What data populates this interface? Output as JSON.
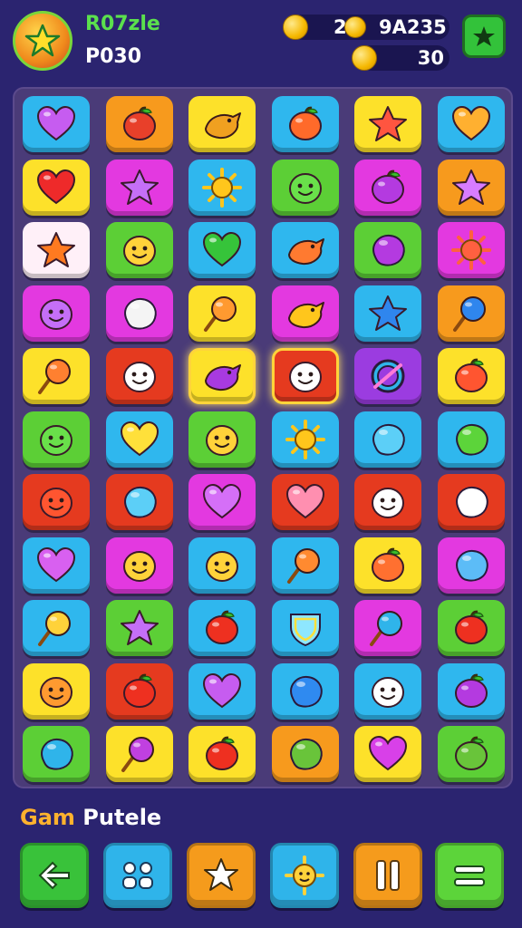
{
  "header": {
    "title": "R07zle",
    "subtitle": "P030",
    "coins_a": "2",
    "gems_a": "9A235",
    "coins_b": "30"
  },
  "footer": {
    "label_a": "Gam",
    "label_b": "Putele",
    "buttons": [
      {
        "name": "back-button",
        "icon": "arrow-left-icon",
        "color": "#39c23a"
      },
      {
        "name": "characters-button",
        "icon": "characters-icon",
        "color": "#2fb4ea"
      },
      {
        "name": "star-button",
        "icon": "star-icon",
        "color": "#f59b1c"
      },
      {
        "name": "sun-button",
        "icon": "sun-icon",
        "color": "#2fb4ea"
      },
      {
        "name": "pause-button",
        "icon": "pause-icon",
        "color": "#f59b1c"
      },
      {
        "name": "menu-button",
        "icon": "menu-icon",
        "color": "#5cd43a"
      }
    ]
  },
  "colors": {
    "blue": "#2fb7ee",
    "orange": "#f79a1d",
    "yellow": "#fde12a",
    "green": "#5ccf36",
    "magenta": "#e339e0",
    "red": "#e53a1f",
    "purple": "#9b3ce0",
    "pink": "#fff0f8"
  },
  "board": {
    "selected": [
      [
        4,
        2
      ],
      [
        4,
        3
      ]
    ],
    "rows": [
      [
        {
          "bg": "blue",
          "icon": "heart",
          "fill": "#c65cf0"
        },
        {
          "bg": "orange",
          "icon": "apple",
          "fill": "#e8402a"
        },
        {
          "bg": "yellow",
          "icon": "bird",
          "fill": "#f0a020"
        },
        {
          "bg": "blue",
          "icon": "apple",
          "fill": "#ff6a2a"
        },
        {
          "bg": "yellow",
          "icon": "star",
          "fill": "#ff5540"
        },
        {
          "bg": "blue",
          "icon": "heart",
          "fill": "#ffb030"
        }
      ],
      [
        {
          "bg": "yellow",
          "icon": "heart",
          "fill": "#ee2a2a"
        },
        {
          "bg": "magenta",
          "icon": "star",
          "fill": "#c56ff7"
        },
        {
          "bg": "blue",
          "icon": "sun",
          "fill": "#ffc61c"
        },
        {
          "bg": "green",
          "icon": "face",
          "fill": "#69e04a"
        },
        {
          "bg": "magenta",
          "icon": "apple",
          "fill": "#b43ae0"
        },
        {
          "bg": "orange",
          "icon": "star",
          "fill": "#d87cff"
        }
      ],
      [
        {
          "bg": "pink",
          "icon": "star",
          "fill": "#ff7a20"
        },
        {
          "bg": "green",
          "icon": "face",
          "fill": "#ffd23a"
        },
        {
          "bg": "blue",
          "icon": "heart",
          "fill": "#36c43a"
        },
        {
          "bg": "blue",
          "icon": "bird",
          "fill": "#ff7a30"
        },
        {
          "bg": "green",
          "icon": "blob",
          "fill": "#b43ae0"
        },
        {
          "bg": "magenta",
          "icon": "sun",
          "fill": "#ff6040"
        }
      ],
      [
        {
          "bg": "magenta",
          "icon": "face",
          "fill": "#c56ff7"
        },
        {
          "bg": "magenta",
          "icon": "blob",
          "fill": "#f4f4f4"
        },
        {
          "bg": "yellow",
          "icon": "lolli",
          "fill": "#ff9a30"
        },
        {
          "bg": "magenta",
          "icon": "bird",
          "fill": "#ffc61c"
        },
        {
          "bg": "blue",
          "icon": "star",
          "fill": "#2f86ee"
        },
        {
          "bg": "orange",
          "icon": "lolli",
          "fill": "#2f86ee"
        }
      ],
      [
        {
          "bg": "yellow",
          "icon": "lolli",
          "fill": "#ff8030"
        },
        {
          "bg": "red",
          "icon": "face",
          "fill": "#ffffff"
        },
        {
          "bg": "yellow",
          "icon": "bird",
          "fill": "#a83ae0"
        },
        {
          "bg": "red",
          "icon": "face",
          "fill": "#ffffff"
        },
        {
          "bg": "purple",
          "icon": "ring",
          "fill": "#2fb4ea"
        },
        {
          "bg": "yellow",
          "icon": "apple",
          "fill": "#ff5530"
        }
      ],
      [
        {
          "bg": "green",
          "icon": "face",
          "fill": "#69e04a"
        },
        {
          "bg": "blue",
          "icon": "heart",
          "fill": "#ffe03a"
        },
        {
          "bg": "green",
          "icon": "face",
          "fill": "#ffd23a"
        },
        {
          "bg": "blue",
          "icon": "sun",
          "fill": "#ffc61c"
        },
        {
          "bg": "blue",
          "icon": "blob",
          "fill": "#5ccff7"
        },
        {
          "bg": "blue",
          "icon": "blob",
          "fill": "#5cd43a"
        }
      ],
      [
        {
          "bg": "red",
          "icon": "face",
          "fill": "#ff5530"
        },
        {
          "bg": "red",
          "icon": "blob",
          "fill": "#5ccff7"
        },
        {
          "bg": "magenta",
          "icon": "heart",
          "fill": "#d56ff7"
        },
        {
          "bg": "red",
          "icon": "heart",
          "fill": "#ff8fb0"
        },
        {
          "bg": "red",
          "icon": "face",
          "fill": "#ffffff"
        },
        {
          "bg": "red",
          "icon": "blob",
          "fill": "#ffffff"
        }
      ],
      [
        {
          "bg": "blue",
          "icon": "heart",
          "fill": "#d860f0"
        },
        {
          "bg": "magenta",
          "icon": "face",
          "fill": "#ffd23a"
        },
        {
          "bg": "blue",
          "icon": "face",
          "fill": "#ffd23a"
        },
        {
          "bg": "blue",
          "icon": "lolli",
          "fill": "#ff8a30"
        },
        {
          "bg": "yellow",
          "icon": "apple",
          "fill": "#ff7030"
        },
        {
          "bg": "magenta",
          "icon": "blob",
          "fill": "#5cbcf7"
        }
      ],
      [
        {
          "bg": "blue",
          "icon": "lolli",
          "fill": "#ffd23a"
        },
        {
          "bg": "green",
          "icon": "star",
          "fill": "#c56ff7"
        },
        {
          "bg": "blue",
          "icon": "apple",
          "fill": "#ee3020"
        },
        {
          "bg": "blue",
          "icon": "shield",
          "fill": "#ffe03a"
        },
        {
          "bg": "magenta",
          "icon": "lolli",
          "fill": "#2fb4ea"
        },
        {
          "bg": "green",
          "icon": "apple",
          "fill": "#ee3020"
        }
      ],
      [
        {
          "bg": "yellow",
          "icon": "face",
          "fill": "#ff9a30"
        },
        {
          "bg": "red",
          "icon": "apple",
          "fill": "#ee3020"
        },
        {
          "bg": "blue",
          "icon": "heart",
          "fill": "#c65cf0"
        },
        {
          "bg": "blue",
          "icon": "blob",
          "fill": "#2f8af0"
        },
        {
          "bg": "blue",
          "icon": "face",
          "fill": "#ffffff"
        },
        {
          "bg": "blue",
          "icon": "apple",
          "fill": "#b43ae0"
        }
      ],
      [
        {
          "bg": "green",
          "icon": "blob",
          "fill": "#2fb4ea"
        },
        {
          "bg": "yellow",
          "icon": "lolli",
          "fill": "#c040e0"
        },
        {
          "bg": "yellow",
          "icon": "apple",
          "fill": "#ee3020"
        },
        {
          "bg": "orange",
          "icon": "blob",
          "fill": "#69c43a"
        },
        {
          "bg": "yellow",
          "icon": "heart",
          "fill": "#d840e8"
        },
        {
          "bg": "green",
          "icon": "apple",
          "fill": "#69c43a"
        }
      ]
    ]
  }
}
